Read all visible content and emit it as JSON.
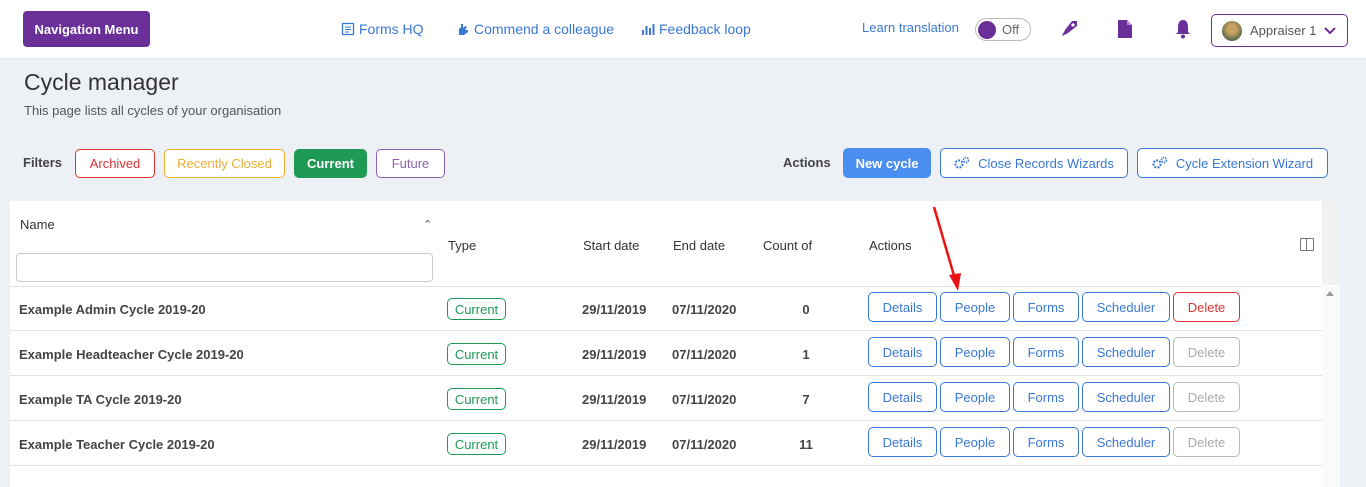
{
  "topbar": {
    "nav_menu_label": "Navigation Menu",
    "links": {
      "forms_hq": "Forms HQ",
      "commend": "Commend a colleague",
      "feedback": "Feedback loop"
    },
    "learn_translation": "Learn translation",
    "toggle_state": "Off",
    "user_label": "Appraiser 1"
  },
  "page": {
    "title": "Cycle manager",
    "subtitle": "This page lists all cycles of your organisation"
  },
  "filters": {
    "label": "Filters",
    "archived": "Archived",
    "recently_closed": "Recently Closed",
    "current": "Current",
    "future": "Future"
  },
  "actions": {
    "label": "Actions",
    "new_cycle": "New cycle",
    "close_records": "Close Records Wizards",
    "cycle_extension": "Cycle Extension Wizard"
  },
  "table": {
    "headers": {
      "name": "Name",
      "type": "Type",
      "start": "Start date",
      "end": "End date",
      "count": "Count of",
      "actions": "Actions"
    },
    "rows": [
      {
        "name": "Example Admin Cycle 2019-20",
        "type": "Current",
        "start": "29/11/2019",
        "end": "07/11/2020",
        "count": "0"
      },
      {
        "name": "Example Headteacher Cycle 2019-20",
        "type": "Current",
        "start": "29/11/2019",
        "end": "07/11/2020",
        "count": "1"
      },
      {
        "name": "Example TA Cycle 2019-20",
        "type": "Current",
        "start": "29/11/2019",
        "end": "07/11/2020",
        "count": "7"
      },
      {
        "name": "Example Teacher Cycle 2019-20",
        "type": "Current",
        "start": "29/11/2019",
        "end": "07/11/2020",
        "count": "11"
      }
    ],
    "row_buttons": {
      "details": "Details",
      "people": "People",
      "forms": "Forms",
      "scheduler": "Scheduler",
      "delete": "Delete"
    }
  },
  "colors": {
    "brand_purple": "#6b2f9a",
    "link_blue": "#3a78d6",
    "current_green": "#1f9a55",
    "delete_red": "#d33333",
    "annotation_arrow": "#ee1111"
  }
}
